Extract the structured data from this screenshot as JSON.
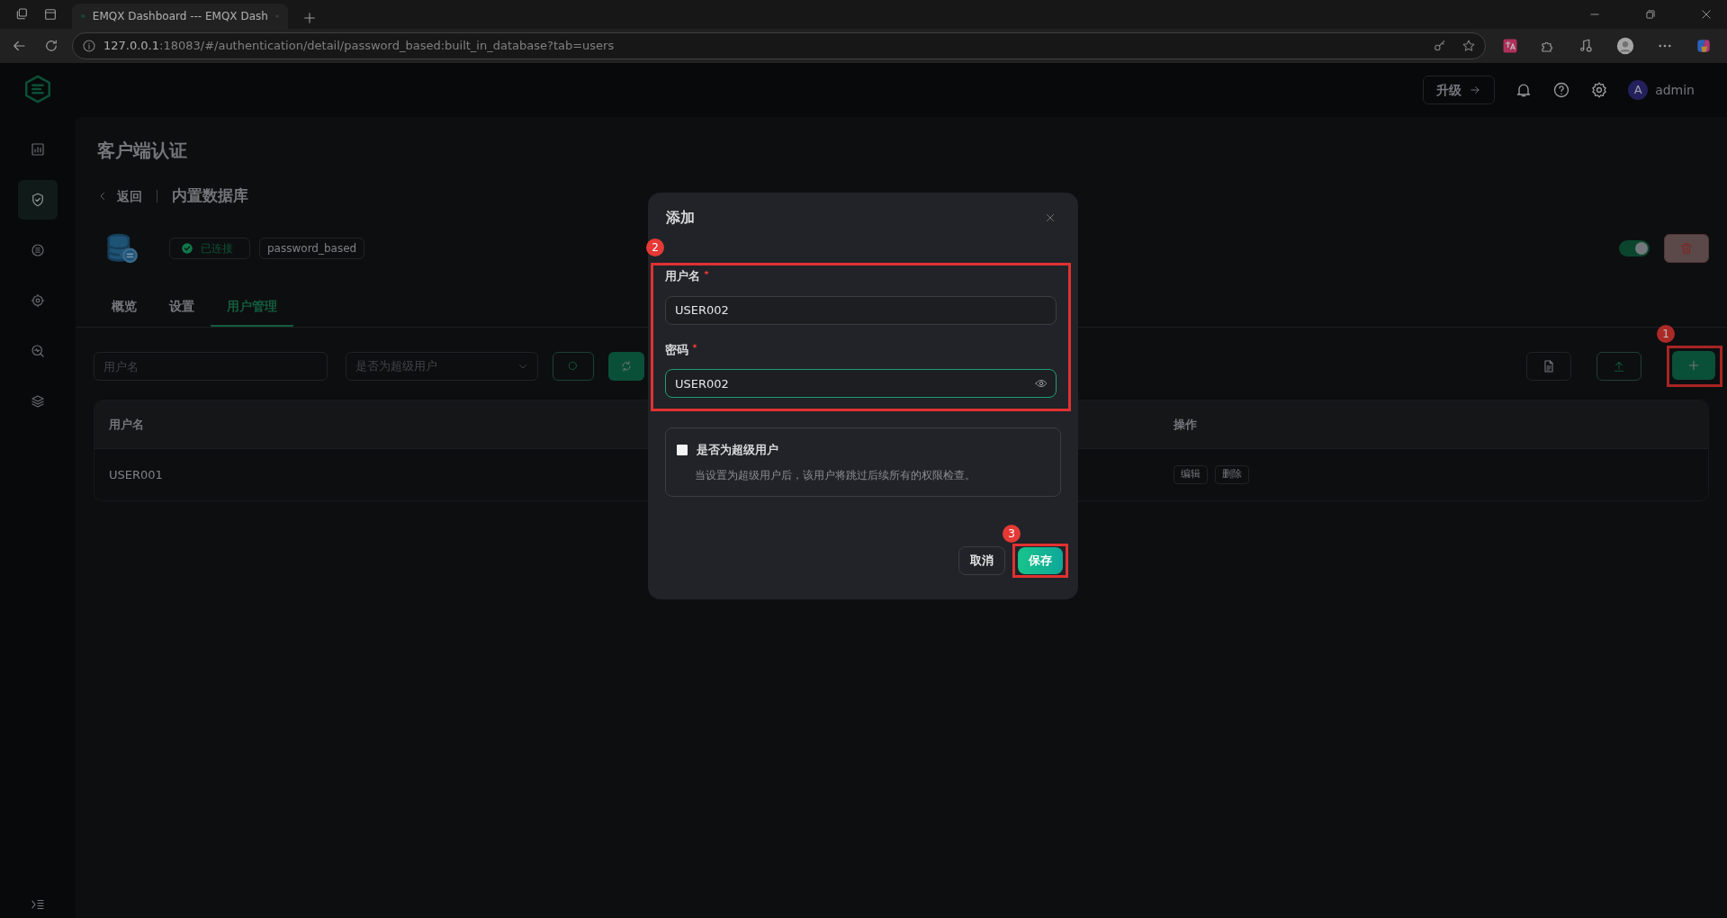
{
  "browser": {
    "tabs": [
      {
        "title": "EMQX Dashboard --- EMQX Dash",
        "selected": true
      }
    ],
    "url": {
      "host": "127.0.0.1",
      "rest": ":18083/#/authentication/detail/password_based:built_in_database?tab=users"
    }
  },
  "header": {
    "upgrade_button": "升级",
    "avatar_letter": "A",
    "user": "admin"
  },
  "sidebar": {
    "items": [
      {
        "selected": false
      },
      {
        "selected": true
      },
      {
        "selected": false
      },
      {
        "selected": false
      },
      {
        "selected": false
      },
      {
        "selected": false
      }
    ]
  },
  "page": {
    "title": "客户端认证",
    "back": "返回",
    "name": "内置数据库",
    "status": "已连接",
    "type_tag": "password_based",
    "enabled": true
  },
  "tabs": [
    {
      "label": "概览",
      "selected": false
    },
    {
      "label": "设置",
      "selected": false
    },
    {
      "label": "用户管理",
      "selected": true
    }
  ],
  "filters": {
    "username": {
      "placeholder": "用户名"
    },
    "superuser": {
      "placeholder": "是否为超级用户"
    }
  },
  "table": {
    "columns": [
      {
        "label": "用户名"
      },
      {
        "label": "操作"
      }
    ],
    "rows": [
      {
        "username": "USER001",
        "actions": [
          "编辑",
          "删除"
        ]
      }
    ]
  },
  "dialog": {
    "title": "添加",
    "fields": [
      {
        "label": "用户名",
        "required": true,
        "value": "USER002",
        "focused": false
      },
      {
        "label": "密码",
        "required": true,
        "value": "USER002",
        "focused": true
      }
    ],
    "superuser": {
      "label": "是否为超级用户",
      "hint": "当设置为超级用户后，该用户将跳过后续所有的权限检查。",
      "checked": false
    },
    "cancel": "取消",
    "save": "保存"
  },
  "annotations": [
    {
      "label": "1"
    },
    {
      "label": "2"
    },
    {
      "label": "3"
    }
  ]
}
